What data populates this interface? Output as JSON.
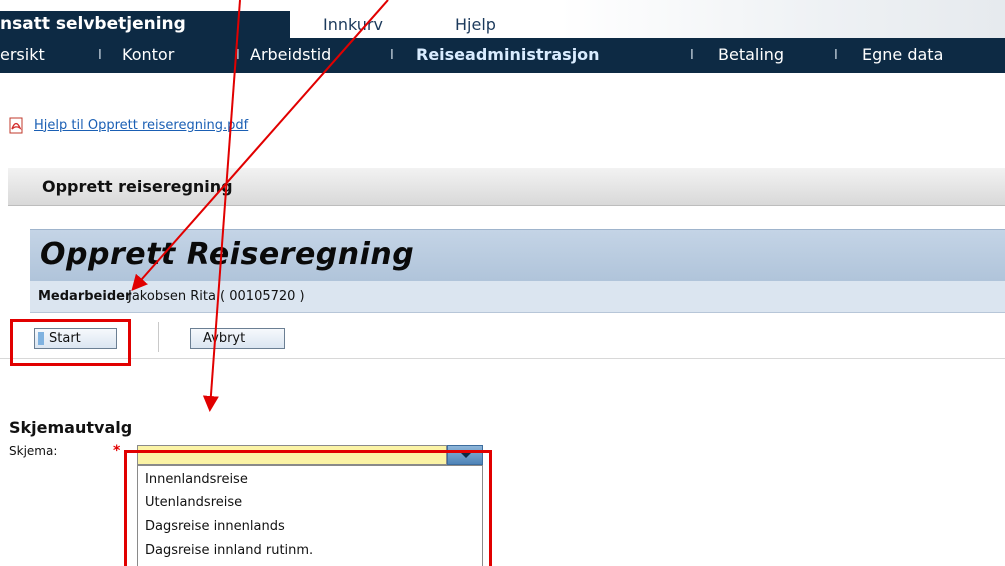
{
  "top_tabs": {
    "active": "nsatt selvbetjening",
    "items": [
      "Innkurv",
      "Hjelp"
    ]
  },
  "nav": {
    "items": [
      "ersikt",
      "Kontor",
      "Arbeidstid",
      "Reiseadministrasjon",
      "Betaling",
      "Egne data"
    ],
    "separator": "I",
    "active_index": 3
  },
  "help": {
    "icon": "pdf-icon",
    "link_text": "Hjelp til Opprett reiseregning.pdf"
  },
  "page": {
    "title": "Opprett reiseregning",
    "header_title": "Opprett Reiseregning",
    "employee_label": "Medarbeider",
    "employee_value": "Jakobsen Rita ( 00105720 )"
  },
  "toolbar": {
    "start_label": "Start",
    "cancel_label": "Avbryt"
  },
  "form": {
    "section_title": "Skjemautvalg",
    "field_label": "Skjema:",
    "required_mark": "*",
    "selected_value": "",
    "options": [
      "Innenlandsreise",
      "Utenlandsreise",
      "Dagsreise innenlands",
      "Dagsreise innland rutinm."
    ]
  },
  "annotation": {
    "highlight_color": "#e10000"
  }
}
